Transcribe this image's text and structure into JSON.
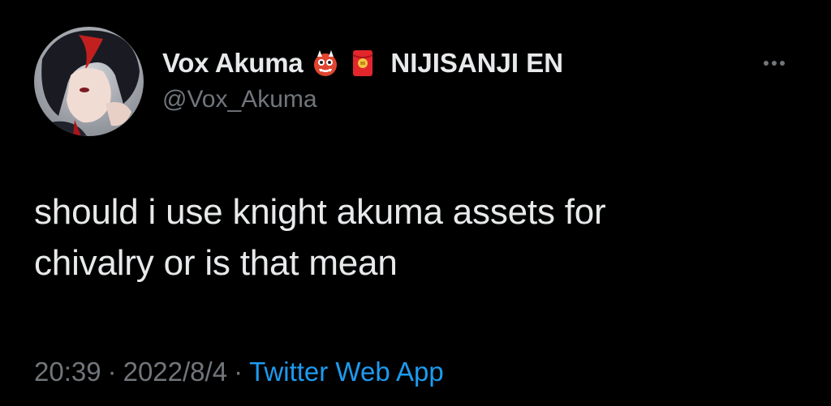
{
  "tweet": {
    "author": {
      "display_name": "Vox Akuma",
      "affiliation": "NIJISANJI EN",
      "handle": "@Vox_Akuma",
      "badges": [
        "ogre-emoji-icon",
        "red-envelope-emoji-icon"
      ]
    },
    "text_line1": "should i use knight akuma assets for",
    "text_line2": "chivalry or is that mean",
    "time": "20:39",
    "date": "2022/8/4",
    "separator": "·",
    "source": "Twitter Web App"
  },
  "colors": {
    "background": "#000000",
    "text_primary": "#e7e9ea",
    "text_secondary": "#71767b",
    "link": "#1d9bf0"
  },
  "icons": {
    "more": "more-horizontal-icon"
  }
}
